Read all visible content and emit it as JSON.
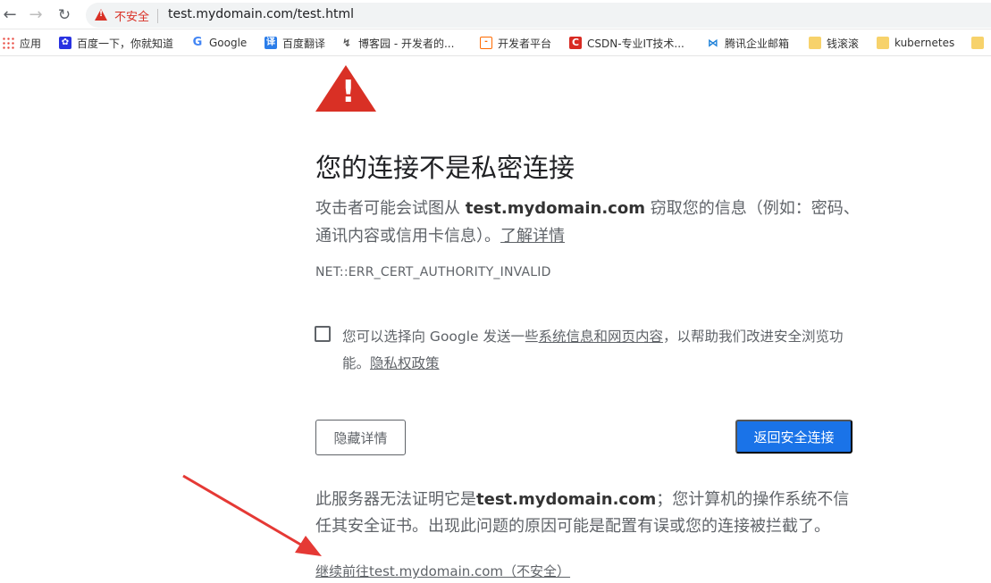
{
  "browser": {
    "security_label": "不安全",
    "url": "test.mydomain.com/test.html",
    "bookmarks": [
      {
        "label": "应用",
        "icon": "apps-grid-icon"
      },
      {
        "label": "百度一下，你就知道",
        "icon": "baidu-icon"
      },
      {
        "label": "Google",
        "icon": "google-icon"
      },
      {
        "label": "百度翻译",
        "icon": "translate-icon"
      },
      {
        "label": "博客园 - 开发者的...",
        "icon": "cnblogs-icon"
      },
      {
        "label": "开发者平台",
        "icon": "dev-platform-icon"
      },
      {
        "label": "CSDN-专业IT技术...",
        "icon": "csdn-icon"
      },
      {
        "label": "腾讯企业邮箱",
        "icon": "tencent-mail-icon"
      },
      {
        "label": "钱滚滚",
        "icon": "folder-icon"
      },
      {
        "label": "kubernetes",
        "icon": "folder-icon"
      }
    ]
  },
  "page": {
    "title": "您的连接不是私密连接",
    "desc_prefix": "攻击者可能会试图从 ",
    "desc_domain": "test.mydomain.com",
    "desc_suffix": " 窃取您的信息（例如：密码、通讯内容或信用卡信息）。",
    "learn_more": "了解详情",
    "error_code": "NET::ERR_CERT_AUTHORITY_INVALID",
    "checkbox_prefix": "您可以选择向 Google 发送一些",
    "checkbox_link": "系统信息和网页内容",
    "checkbox_suffix": "，以帮助我们改进安全浏览功能。",
    "privacy_link": "隐私权政策",
    "hide_details_button": "隐藏详情",
    "back_button": "返回安全连接",
    "details_prefix": "此服务器无法证明它是",
    "details_domain": "test.mydomain.com",
    "details_suffix": "；您计算机的操作系统不信任其安全证书。出现此问题的原因可能是配置有误或您的连接被拦截了。",
    "proceed_link": "继续前往test.mydomain.com（不安全）"
  },
  "colors": {
    "danger": "#d93025",
    "primary": "#1a73e8",
    "arrow": "#e53935"
  }
}
